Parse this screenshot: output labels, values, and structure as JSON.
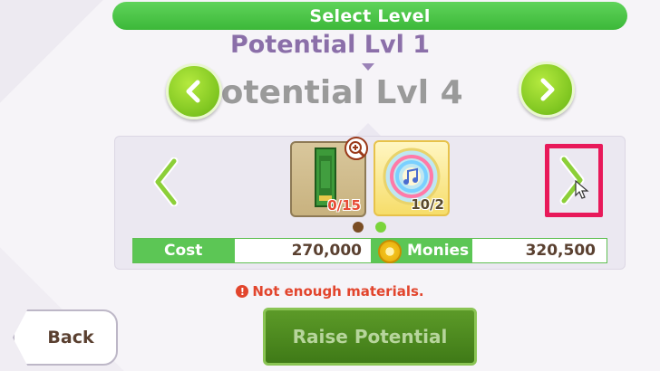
{
  "header": {
    "title": "Select Level",
    "current_level": "Potential Lvl 1",
    "target_level": "Potential Lvl 4"
  },
  "materials": [
    {
      "name": "green-book-item",
      "count": "0/15"
    },
    {
      "name": "rainbow-badge-item",
      "count": "10/2"
    }
  ],
  "cost": {
    "label": "Cost",
    "value": "270,000",
    "currency_label": "Monies",
    "currency_value": "320,500"
  },
  "warning": {
    "icon": "!",
    "text": "Not enough materials."
  },
  "buttons": {
    "back": "Back",
    "raise": "Raise Potential"
  },
  "colors": {
    "accent_green": "#5cc655",
    "highlight": "#e8195a",
    "warning_red": "#e2452d"
  }
}
